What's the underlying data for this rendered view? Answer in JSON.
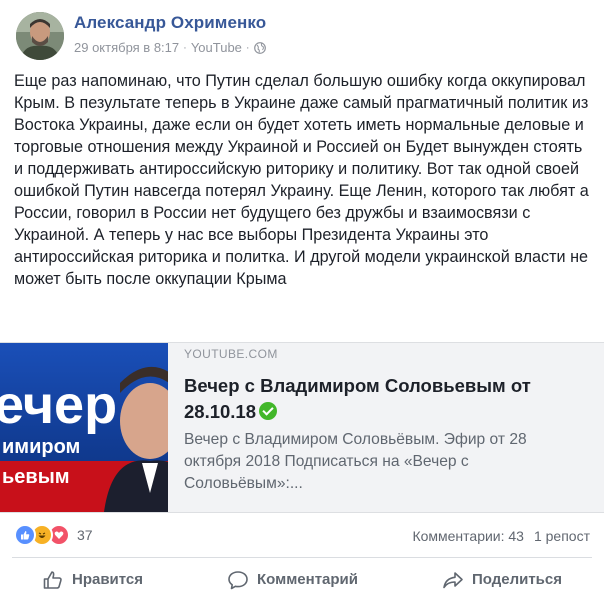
{
  "post": {
    "author": "Александр Охрименко",
    "date": "29 октября в 8:17",
    "separator": "·",
    "source": "YouTube",
    "text": "Еще раз напоминаю, что Путин сделал большую ошибку когда оккупировал Крым. В пезультате теперь в Украине даже самый прагматичный политик из Востока Украины, даже если он будет хотеть иметь нормальные деловые и торговые отношения между Украиной и Россией он Будет вынужден стоять и поддерживать антироссийскую риторику и политику. Вот так одной своей ошибкой Путин навсегда потерял Украину. Еще Ленин, которого так любят а России, говорил в России нет будущего без дружбы и взаимосвязи с Украиной. А теперь у нас все выборы Президента Украины это антироссийская риторика и политка. И другой модели украинской власти не может быть после оккупации Крыма"
  },
  "link_card": {
    "domain": "YOUTUBE.COM",
    "title": "Вечер с Владимиром Соловьевым от 28.10.18",
    "description": "Вечер с Владимиром Соловьёвым. Эфир от 28 октября 2018 Подписаться на «Вечер с Соловьёвым»:...",
    "thumb_text_large": "ечер",
    "thumb_text_mid": "имиром",
    "thumb_text_small": "ьевым"
  },
  "reactions": {
    "count": "37",
    "icons": [
      "like-icon",
      "haha-icon",
      "love-icon"
    ]
  },
  "stats": {
    "comments": "Комментарии: 43",
    "shares": "1 репост"
  },
  "actions": {
    "like": "Нравится",
    "comment": "Комментарий",
    "share": "Поделиться"
  },
  "colors": {
    "author_link": "#385898",
    "meta_gray": "#90949c",
    "like_blue": "#5890ff",
    "verified_green": "#42b72a",
    "thumb_red": "#c8101a",
    "thumb_blue": "#0b2f7a"
  }
}
